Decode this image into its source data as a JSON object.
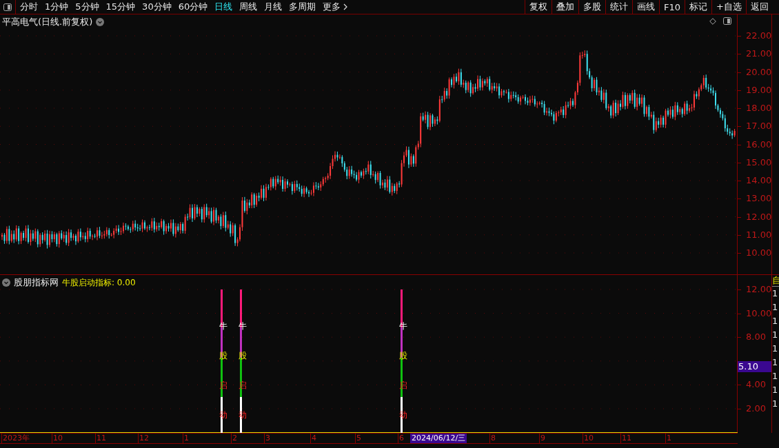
{
  "toolbar": {
    "periods": [
      {
        "label": "分时",
        "selected": false
      },
      {
        "label": "1分钟",
        "selected": false
      },
      {
        "label": "5分钟",
        "selected": false
      },
      {
        "label": "15分钟",
        "selected": false
      },
      {
        "label": "30分钟",
        "selected": false
      },
      {
        "label": "60分钟",
        "selected": false
      },
      {
        "label": "日线",
        "selected": true
      },
      {
        "label": "周线",
        "selected": false
      },
      {
        "label": "月线",
        "selected": false
      },
      {
        "label": "多周期",
        "selected": false
      }
    ],
    "more": "更多",
    "actions": [
      "复权",
      "叠加",
      "多股",
      "统计",
      "画线",
      "F10",
      "标记",
      "+自选",
      "返回"
    ]
  },
  "price_pane": {
    "title": "平高电气(日线.前复权)",
    "y_axis_labels": [
      "22.00",
      "21.00",
      "20.00",
      "19.00",
      "18.00",
      "17.00",
      "16.00",
      "15.00",
      "14.00",
      "13.00",
      "12.00",
      "11.00",
      "10.00"
    ]
  },
  "indicator_pane": {
    "source": "股朋指标网",
    "name": "牛股启动指标: 0.00",
    "y_axis_labels": [
      "12.00",
      "10.00",
      "8.00",
      "4.00",
      "2.00"
    ],
    "readout": "5.10",
    "signals": [
      {
        "labels": [
          "牛",
          "股",
          "启",
          "动"
        ]
      },
      {
        "labels": [
          "牛",
          "股",
          "启",
          "动"
        ]
      },
      {
        "labels": [
          "牛",
          "股",
          "启",
          "动"
        ]
      }
    ]
  },
  "time_axis": {
    "labels": [
      "2023年",
      "10",
      "11",
      "12",
      "1",
      "2",
      "3",
      "4",
      "5",
      "6",
      "8",
      "9",
      "10",
      "11",
      "1"
    ],
    "cursor_date": "2024/06/12/三"
  },
  "side_panel": {
    "header": "自",
    "rows": [
      "1",
      "1",
      "1",
      "1",
      "1",
      "1",
      "1",
      "1",
      "1"
    ]
  }
}
